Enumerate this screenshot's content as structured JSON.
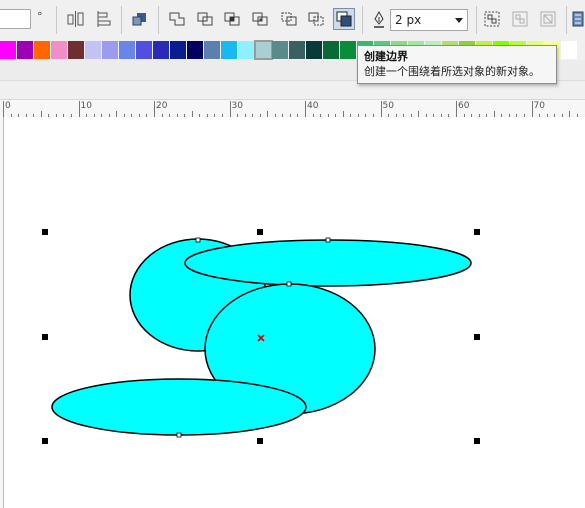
{
  "toolbar": {
    "rotation_value": "",
    "rotation_unit": "°",
    "outline_width": "2 px",
    "icons": [
      "align-distribute-icon",
      "align-stack-icon",
      "arrange-order-icon",
      "weld-icon",
      "trim-icon",
      "intersect-icon",
      "simplify-icon",
      "front-minus-back-icon",
      "back-minus-front-icon",
      "create-boundary-icon",
      "outline-pen-icon",
      "group-icon",
      "ungroup-icon",
      "ungroup-all-icon",
      "combine-icon"
    ],
    "active_tool": "create-boundary"
  },
  "palette": {
    "colors": [
      "#ff00ff",
      "#9b00b4",
      "#ff6600",
      "#f08ec7",
      "#6d2f2f",
      "#c2c2f6",
      "#9b9bf0",
      "#6a85e8",
      "#5050e0",
      "#2a2ab8",
      "#0a1c90",
      "#000060",
      "#5a7fb0",
      "#1ab8f0",
      "#90f0ff",
      "#a8d0d0",
      "#5a8a8a",
      "#3a6060",
      "#083a3a",
      "#0a6a36",
      "#0a8c3c",
      "#3ab86a",
      "#5acb7a",
      "#8adb8a",
      "#a0e8a0",
      "#b8f0b8",
      "#b0e070",
      "#90d040",
      "#c0f040",
      "#80ff00",
      "#b4ff3a",
      "#e0ff7a",
      "#f8ff90",
      "#ffffff"
    ],
    "selected_index": 15
  },
  "tooltip": {
    "title": "创建边界",
    "description": "创建一个围绕着所选对象的新对象。"
  },
  "ruler": {
    "labels": [
      "0",
      "10",
      "20",
      "30",
      "40",
      "50",
      "60",
      "70"
    ]
  },
  "drawing": {
    "fill_color": "#00ffff",
    "stroke_color": "#000000",
    "shapes": [
      {
        "name": "ellipse-upper-left"
      },
      {
        "name": "ellipse-wide-top"
      },
      {
        "name": "ellipse-center"
      },
      {
        "name": "ellipse-bottom"
      }
    ]
  }
}
